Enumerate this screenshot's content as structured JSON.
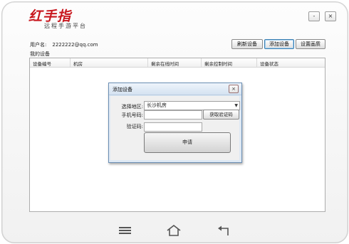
{
  "app": {
    "brand": "红手指",
    "subtitle": "远程手游平台",
    "min_label": "-",
    "close_label": "×",
    "brand_color": "#c8161d"
  },
  "user": {
    "label": "用户名:",
    "value": "2222222@qq.com"
  },
  "toolbar": {
    "refresh": "刷新设备",
    "add": "添加设备",
    "resolution": "设置画质"
  },
  "devices": {
    "label": "我的设备",
    "columns": [
      "设备编号",
      "机房",
      "剩余在线时间",
      "剩余控制时间",
      "设备状态"
    ],
    "rows": []
  },
  "dialog": {
    "title": "添加设备",
    "close": "×",
    "region_label": "选择地区:",
    "region_value": "长沙机房",
    "phone_label": "手机号码:",
    "phone_value": "",
    "code_label": "验证码:",
    "code_value": "",
    "get_code": "获取验证码",
    "apply": "申请"
  },
  "icons": {
    "menu": "menu-icon",
    "home": "home-icon",
    "back": "back-icon",
    "dropdown": "chevron-down-icon"
  }
}
